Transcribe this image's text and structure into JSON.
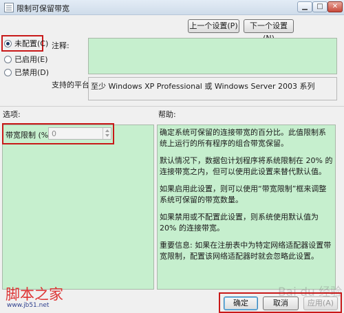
{
  "window": {
    "title": "限制可保留带宽",
    "controls": {
      "minimize": "▁",
      "maximize": "□",
      "close": "✕"
    },
    "icon": "policy-document-icon"
  },
  "nav": {
    "prev": "上一个设置(P)",
    "next": "下一个设置(N)"
  },
  "state": {
    "options": [
      {
        "label": "未配置(C)",
        "selected": true
      },
      {
        "label": "已启用(E)",
        "selected": false
      },
      {
        "label": "已禁用(D)",
        "selected": false
      }
    ]
  },
  "comment": {
    "label": "注释:",
    "value": ""
  },
  "platform": {
    "label": "支持的平台:",
    "value": "至少 Windows XP Professional 或 Windows Server 2003 系列"
  },
  "options_section": {
    "label": "选项:",
    "bandwidth_label": "带宽限制 (%):",
    "bandwidth_value": "0"
  },
  "help": {
    "label": "帮助:",
    "paragraphs": [
      "确定系统可保留的连接带宽的百分比。此值限制系统上运行的所有程序的组合带宽保留。",
      "默认情况下，数据包计划程序将系统限制在 20% 的连接带宽之内，但可以使用此设置来替代默认值。",
      "如果启用此设置，则可以使用“带宽限制”框来调整系统可保留的带宽数量。",
      "如果禁用或不配置此设置，则系统使用默认值为 20% 的连接带宽。",
      "重要信息: 如果在注册表中为特定网络适配器设置带宽限制，配置该网络适配器时就会忽略此设置。"
    ]
  },
  "buttons": {
    "ok": "确定",
    "cancel": "取消",
    "apply": "应用(A)"
  },
  "watermark": {
    "site": "脚本之家",
    "url": "www.jb51.net",
    "baidu": "Bai du 经验"
  },
  "colors": {
    "green_panel": "#c6efce",
    "highlight": "#c81818"
  }
}
